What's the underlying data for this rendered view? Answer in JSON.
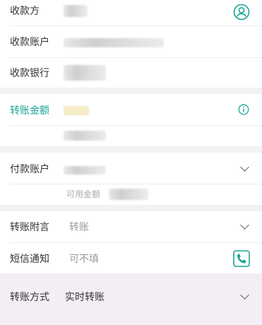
{
  "payee": {
    "name_label": "收款方",
    "account_label": "收款账户",
    "bank_label": "收款银行",
    "contact_icon": "person-circle-icon"
  },
  "amount": {
    "label": "转账金额",
    "info_icon": "info-circle-icon"
  },
  "payer": {
    "label": "付款账户",
    "available_label": "可用金额"
  },
  "memo": {
    "label": "转账附言",
    "placeholder": "转账"
  },
  "sms": {
    "label": "短信通知",
    "placeholder": "可不填",
    "phone_icon": "phone-book-icon"
  },
  "method": {
    "label": "转账方式",
    "value": "实时转账"
  },
  "colors": {
    "accent": "#1aa596",
    "background": "#f2f2f2",
    "highlight": "#f3eef6"
  }
}
